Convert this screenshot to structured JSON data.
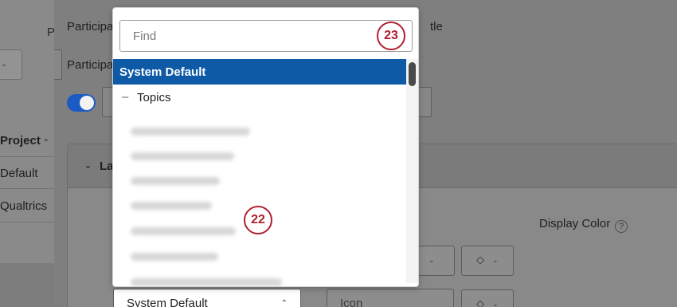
{
  "left_panel": {
    "select_caret": "⌄",
    "partial_label": "P",
    "column_heading": "Project",
    "column_sort_icon": "sort-ascending-icon",
    "rows": [
      "Default",
      "Qualtrics"
    ]
  },
  "form": {
    "participant_label_1": "Participa",
    "participant_label_2": "Participa",
    "partial_title": "tle",
    "toggle_on": true
  },
  "section": {
    "title_partial": "La",
    "display_color_label": "Display Color",
    "help_icon": "question-circle-icon"
  },
  "rows": {
    "system_default_select": "System Default",
    "icon_select": "Icon"
  },
  "dropdown": {
    "search_placeholder": "Find",
    "selected_option": "System Default",
    "group_label": "Topics",
    "group_collapse_icon": "minus-icon",
    "blurred_option_count": 7
  },
  "annotations": {
    "callout_search": "23",
    "callout_list": "22"
  },
  "colors": {
    "selected_bg": "#0e5aa7",
    "callout": "#b0202f",
    "toggle": "#1c5bc4"
  }
}
